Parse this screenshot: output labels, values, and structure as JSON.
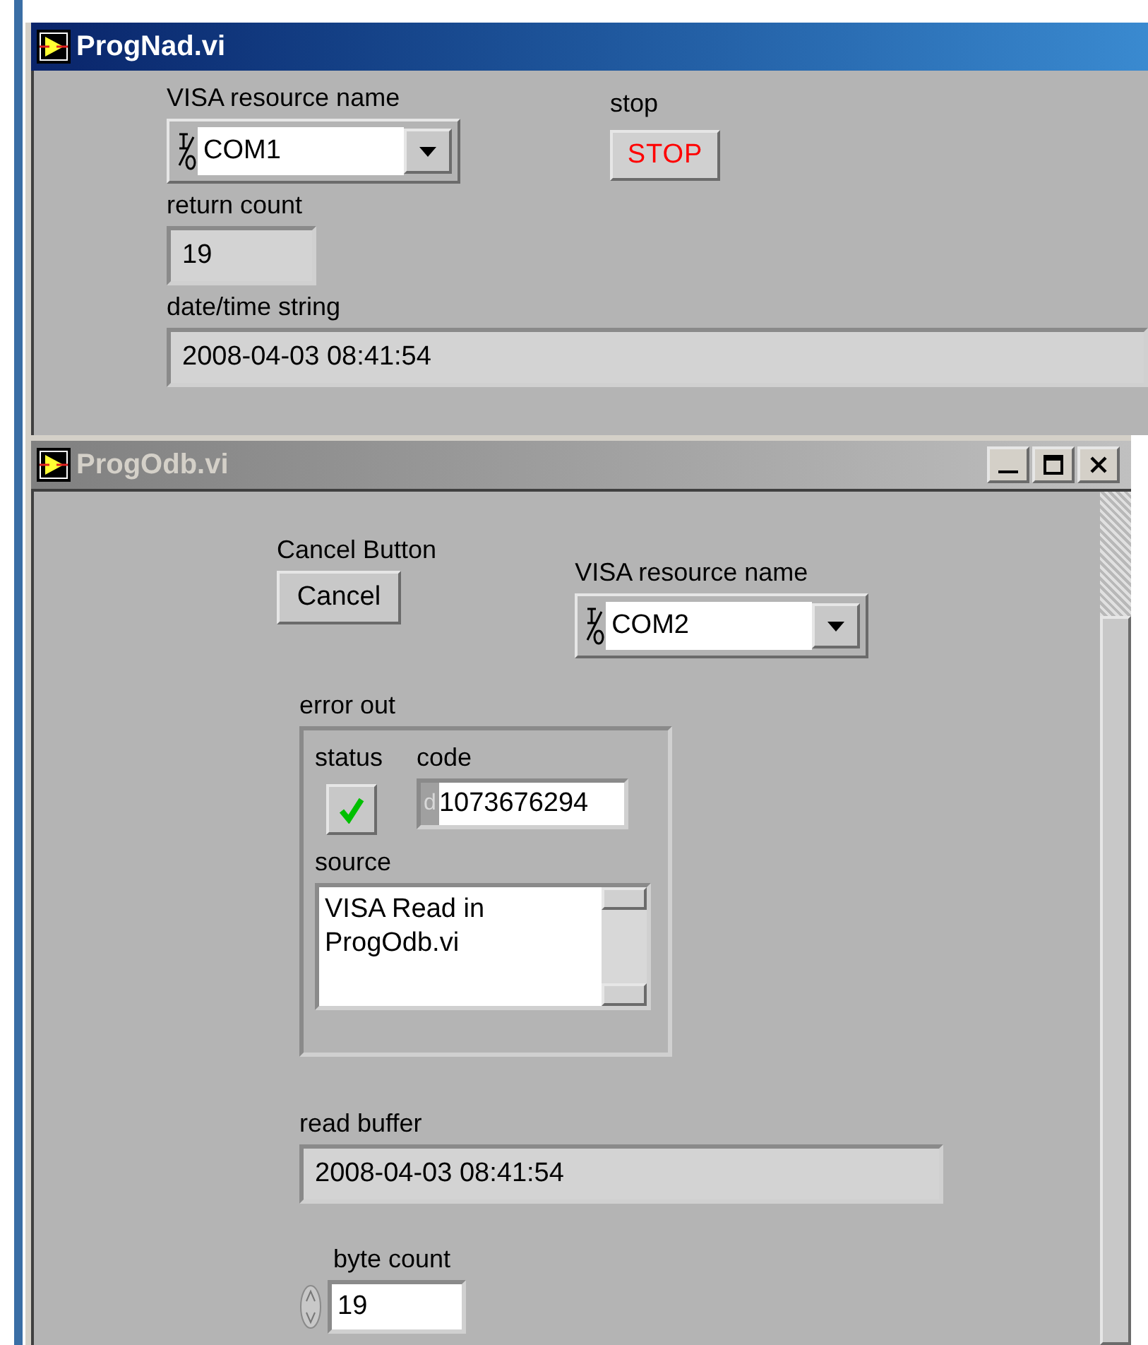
{
  "windows": [
    {
      "title": "ProgNad.vi",
      "active": true,
      "visa": {
        "label": "VISA resource name",
        "value": "COM1"
      },
      "stop": {
        "label": "stop",
        "button": "STOP"
      },
      "return_count": {
        "label": "return count",
        "value": "19"
      },
      "datetime": {
        "label": "date/time string",
        "value": "2008-04-03 08:41:54"
      }
    },
    {
      "title": "ProgOdb.vi",
      "active": false,
      "cancel": {
        "label": "Cancel Button",
        "button": "Cancel"
      },
      "visa": {
        "label": "VISA resource name",
        "value": "COM2"
      },
      "error_out": {
        "label": "error out",
        "status": {
          "label": "status",
          "ok": true
        },
        "code": {
          "label": "code",
          "radix": "d",
          "value": "1073676294"
        },
        "source": {
          "label": "source",
          "value": "VISA Read in ProgOdb.vi"
        }
      },
      "read_buffer": {
        "label": "read buffer",
        "value": "2008-04-03 08:41:54"
      },
      "byte_count": {
        "label": "byte count",
        "value": "19"
      }
    }
  ]
}
